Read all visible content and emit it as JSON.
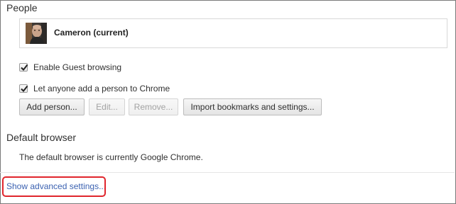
{
  "people": {
    "title": "People",
    "profile": {
      "name": "Cameron (current)",
      "avatar_icon": "user-photo-avatar"
    },
    "options": [
      {
        "label": "Enable Guest browsing",
        "checked": true
      },
      {
        "label": "Let anyone add a person to Chrome",
        "checked": true
      }
    ],
    "buttons": {
      "add": "Add person...",
      "edit": "Edit...",
      "remove": "Remove...",
      "import": "Import bookmarks and settings..."
    }
  },
  "default_browser": {
    "title": "Default browser",
    "status": "The default browser is currently Google Chrome."
  },
  "advanced": {
    "link": "Show advanced settings..."
  },
  "colors": {
    "link": "#3c62b1",
    "highlight": "#e0262d"
  }
}
